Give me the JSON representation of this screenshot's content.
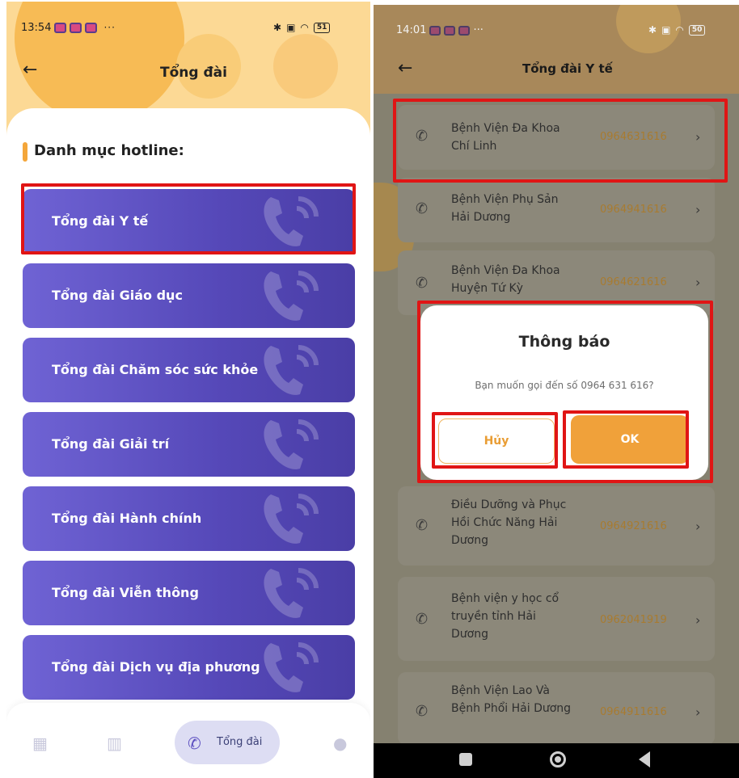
{
  "left_phone": {
    "status_time": "13:54",
    "status_dots": "···",
    "battery": "51",
    "title": "Tổng đài",
    "category_title": "Danh mục hotline:",
    "hotlines": [
      "Tổng đài Y tế",
      "Tổng đài Giáo dục",
      "Tổng đài Chăm sóc sức khỏe",
      "Tổng đài Giải trí",
      "Tổng đài Hành chính",
      "Tổng đài Viễn thông",
      "Tổng đài Dịch vụ địa phương"
    ],
    "bottom_nav": {
      "active_label": "Tổng đài",
      "items": [
        "grid-icon",
        "map-icon",
        "phone-icon",
        "profile-icon"
      ]
    }
  },
  "right_phone": {
    "status_time": "14:01",
    "status_dots": "···",
    "battery": "50",
    "title": "Tổng đài Y tế",
    "hospitals": [
      {
        "name": "Bệnh Viện Đa Khoa Chí Linh",
        "phone": "0964631616"
      },
      {
        "name": "Bệnh Viện Phụ Sản Hải Dương",
        "phone": "0964941616"
      },
      {
        "name": "Bệnh Viện Đa Khoa Huyện Tứ Kỳ",
        "phone": "0964621616"
      },
      {
        "name": "Điều Dưỡng và Phục Hồi Chức Năng Hải Dương",
        "phone": "0964921616"
      },
      {
        "name": "Bệnh viện y học cổ truyền tỉnh Hải Dương",
        "phone": "0962041919"
      },
      {
        "name": "Bệnh Viện Lao Và Bệnh Phổi Hải Dương",
        "phone": "0964911616"
      }
    ],
    "dialog": {
      "title": "Thông báo",
      "message": "Bạn muốn gọi đến số 0964 631 616?",
      "cancel_label": "Hủy",
      "ok_label": "OK"
    }
  },
  "colors": {
    "accent_orange": "#f0a13a",
    "hotline_purple": "#5548b8",
    "highlight_red": "#e01515"
  }
}
